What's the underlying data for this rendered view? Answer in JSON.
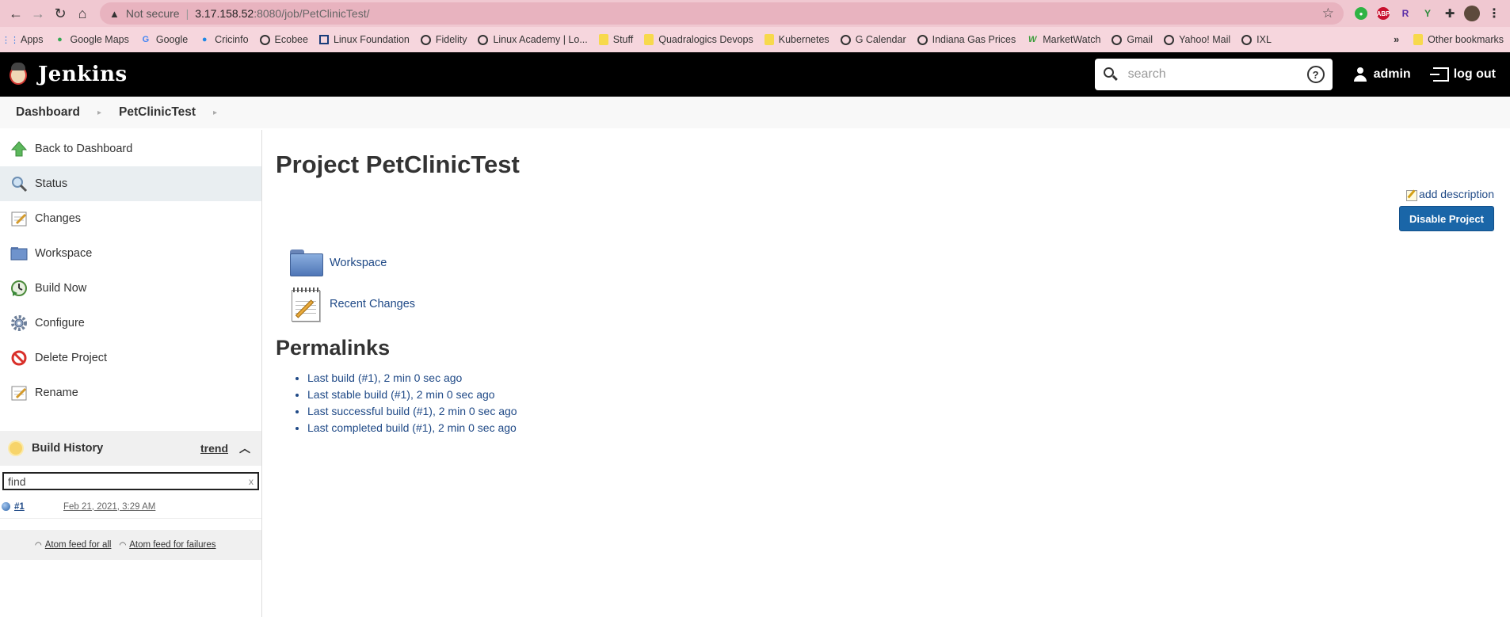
{
  "browser": {
    "url_not_secure": "Not secure",
    "url_host": "3.17.158.52",
    "url_path": ":8080/job/PetClinicTest/",
    "bookmarks": [
      "Apps",
      "Google Maps",
      "Google",
      "Cricinfo",
      "Ecobee",
      "Linux Foundation",
      "Fidelity",
      "Linux Academy | Lo...",
      "Stuff",
      "Quadralogics Devops",
      "Kubernetes",
      "G Calendar",
      "Indiana Gas Prices",
      "MarketWatch",
      "Gmail",
      "Yahoo! Mail",
      "IXL"
    ],
    "more_bookmarks": "»",
    "other_bookmarks": "Other bookmarks"
  },
  "header": {
    "title": "Jenkins",
    "search_placeholder": "search",
    "user": "admin",
    "logout": "log out"
  },
  "breadcrumb": [
    "Dashboard",
    "PetClinicTest"
  ],
  "sidebar": {
    "tasks": [
      {
        "label": "Back to Dashboard",
        "icon": "up-arrow-icon"
      },
      {
        "label": "Status",
        "icon": "magnifier-icon",
        "active": true
      },
      {
        "label": "Changes",
        "icon": "notepad-icon"
      },
      {
        "label": "Workspace",
        "icon": "folder-icon"
      },
      {
        "label": "Build Now",
        "icon": "clock-play-icon"
      },
      {
        "label": "Configure",
        "icon": "gear-icon"
      },
      {
        "label": "Delete Project",
        "icon": "no-entry-icon"
      },
      {
        "label": "Rename",
        "icon": "notepad-icon"
      }
    ],
    "build_history": {
      "title": "Build History",
      "trend": "trend",
      "filter_placeholder": "find",
      "clear": "x",
      "builds": [
        {
          "number": "#1",
          "date": "Feb 21, 2021, 3:29 AM"
        }
      ],
      "feed_all": "Atom feed for all",
      "feed_failures": "Atom feed for failures"
    }
  },
  "main": {
    "title": "Project PetClinicTest",
    "add_description": "add description",
    "disable_button": "Disable Project",
    "links": [
      {
        "label": "Workspace",
        "icon": "folder-icon"
      },
      {
        "label": "Recent Changes",
        "icon": "notepad-icon"
      }
    ],
    "permalinks_title": "Permalinks",
    "permalinks": [
      "Last build (#1), 2 min 0 sec ago",
      "Last stable build (#1), 2 min 0 sec ago",
      "Last successful build (#1), 2 min 0 sec ago",
      "Last completed build (#1), 2 min 0 sec ago"
    ]
  },
  "colors": {
    "header_bg": "#000000",
    "link": "#204a87",
    "button": "#1a66a8"
  }
}
